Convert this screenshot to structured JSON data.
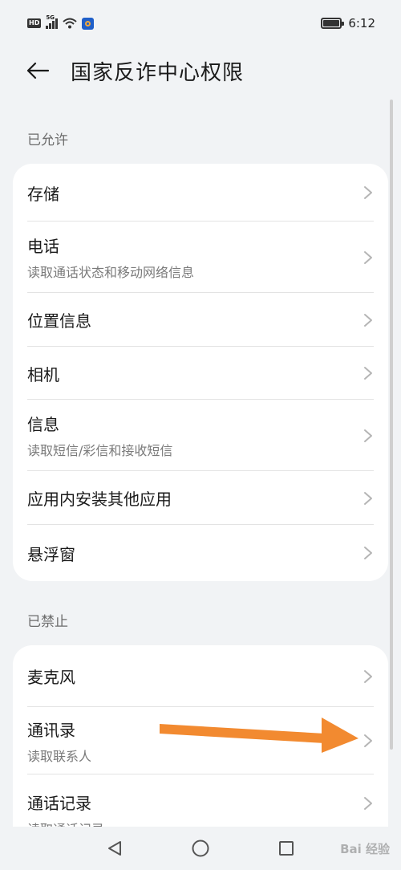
{
  "status_bar": {
    "left_badge": "HD",
    "network_label": "5G",
    "time": "6:12"
  },
  "header": {
    "title": "国家反诈中心权限"
  },
  "sections": {
    "allowed_label": "已允许",
    "denied_label": "已禁止"
  },
  "allowed_items": [
    {
      "title": "存储",
      "subtitle": ""
    },
    {
      "title": "电话",
      "subtitle": "读取通话状态和移动网络信息"
    },
    {
      "title": "位置信息",
      "subtitle": ""
    },
    {
      "title": "相机",
      "subtitle": ""
    },
    {
      "title": "信息",
      "subtitle": "读取短信/彩信和接收短信"
    },
    {
      "title": "应用内安装其他应用",
      "subtitle": ""
    },
    {
      "title": "悬浮窗",
      "subtitle": ""
    }
  ],
  "denied_items": [
    {
      "title": "麦克风",
      "subtitle": ""
    },
    {
      "title": "通讯录",
      "subtitle": "读取联系人"
    },
    {
      "title": "通话记录",
      "subtitle": "读取通话记录"
    }
  ],
  "watermark": "Bai 经验",
  "colors": {
    "background": "#f1f3f5",
    "card": "#ffffff",
    "annotation_arrow": "#f28a30"
  },
  "icons": {
    "back": "arrow-left-icon",
    "chevron": "chevron-right-icon",
    "nav_back": "triangle-back-icon",
    "nav_home": "circle-home-icon",
    "nav_recent": "square-recent-icon"
  }
}
